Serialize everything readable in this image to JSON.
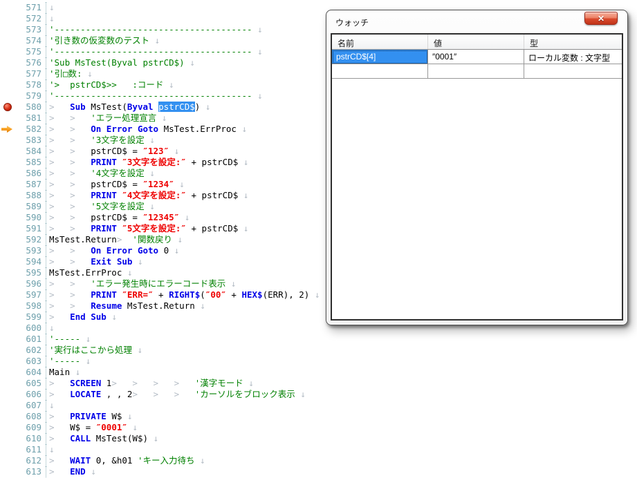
{
  "editor": {
    "colors": {
      "kw": "#0000e8",
      "str": "#ee0000",
      "cm": "#008000",
      "ws": "#b5bdc6",
      "lineno": "#6d9fab",
      "selbg": "#3390f0",
      "bp": "#d42c12",
      "arrow": "#f5991c"
    },
    "lines": [
      {
        "n": 571,
        "m": null,
        "s": [
          [
            "ws",
            "↓"
          ]
        ]
      },
      {
        "n": 572,
        "m": null,
        "s": [
          [
            "ws",
            "↓"
          ]
        ]
      },
      {
        "n": 573,
        "m": null,
        "s": [
          [
            "cm",
            "'--------------------------------------"
          ],
          [
            "ws",
            " ↓"
          ]
        ]
      },
      {
        "n": 574,
        "m": null,
        "s": [
          [
            "cm",
            "'引き数の仮変数のテスト"
          ],
          [
            "ws",
            " ↓"
          ]
        ]
      },
      {
        "n": 575,
        "m": null,
        "s": [
          [
            "cm",
            "'--------------------------------------"
          ],
          [
            "ws",
            " ↓"
          ]
        ]
      },
      {
        "n": 576,
        "m": null,
        "s": [
          [
            "cm",
            "'Sub MsTest(Byval pstrCD$)"
          ],
          [
            "ws",
            " ↓"
          ]
        ]
      },
      {
        "n": 577,
        "m": null,
        "s": [
          [
            "cm",
            "'引□数:"
          ],
          [
            "ws",
            " ↓"
          ]
        ]
      },
      {
        "n": 578,
        "m": null,
        "s": [
          [
            "cm",
            "'>  pstrCD$>>   :コード"
          ],
          [
            "ws",
            " ↓"
          ]
        ]
      },
      {
        "n": 579,
        "m": null,
        "s": [
          [
            "cm",
            "'--------------------------------------"
          ],
          [
            "ws",
            " ↓"
          ]
        ]
      },
      {
        "n": 580,
        "m": "breakpoint",
        "s": [
          [
            "ws",
            ">   "
          ],
          [
            "kw",
            "Sub "
          ],
          [
            "pl",
            "MsTest("
          ],
          [
            "kw",
            "Byval "
          ],
          [
            "sel",
            "pstrCD$"
          ],
          [
            "pl",
            ")"
          ],
          [
            "ws",
            " ↓"
          ]
        ]
      },
      {
        "n": 581,
        "m": null,
        "s": [
          [
            "ws",
            ">   >   "
          ],
          [
            "cm",
            "'エラー処理宣言"
          ],
          [
            "ws",
            " ↓"
          ]
        ]
      },
      {
        "n": 582,
        "m": "arrow",
        "s": [
          [
            "ws",
            ">   >   "
          ],
          [
            "kw",
            "On Error Goto "
          ],
          [
            "pl",
            "MsTest.ErrProc"
          ],
          [
            "ws",
            " ↓"
          ]
        ]
      },
      {
        "n": 583,
        "m": null,
        "s": [
          [
            "ws",
            ">   >   "
          ],
          [
            "cm",
            "'3文字を設定"
          ],
          [
            "ws",
            " ↓"
          ]
        ]
      },
      {
        "n": 584,
        "m": null,
        "s": [
          [
            "ws",
            ">   >   "
          ],
          [
            "pl",
            "pstrCD$ = "
          ],
          [
            "str",
            "″123″"
          ],
          [
            "ws",
            " ↓"
          ]
        ]
      },
      {
        "n": 585,
        "m": null,
        "s": [
          [
            "ws",
            ">   >   "
          ],
          [
            "kw",
            "PRINT "
          ],
          [
            "str",
            "″3文字を設定:″"
          ],
          [
            "pl",
            " + pstrCD$"
          ],
          [
            "ws",
            " ↓"
          ]
        ]
      },
      {
        "n": 586,
        "m": null,
        "s": [
          [
            "ws",
            ">   >   "
          ],
          [
            "cm",
            "'4文字を設定"
          ],
          [
            "ws",
            " ↓"
          ]
        ]
      },
      {
        "n": 587,
        "m": null,
        "s": [
          [
            "ws",
            ">   >   "
          ],
          [
            "pl",
            "pstrCD$ = "
          ],
          [
            "str",
            "″1234″"
          ],
          [
            "ws",
            " ↓"
          ]
        ]
      },
      {
        "n": 588,
        "m": null,
        "s": [
          [
            "ws",
            ">   >   "
          ],
          [
            "kw",
            "PRINT "
          ],
          [
            "str",
            "″4文字を設定:″"
          ],
          [
            "pl",
            " + pstrCD$"
          ],
          [
            "ws",
            " ↓"
          ]
        ]
      },
      {
        "n": 589,
        "m": null,
        "s": [
          [
            "ws",
            ">   >   "
          ],
          [
            "cm",
            "'5文字を設定"
          ],
          [
            "ws",
            " ↓"
          ]
        ]
      },
      {
        "n": 590,
        "m": null,
        "s": [
          [
            "ws",
            ">   >   "
          ],
          [
            "pl",
            "pstrCD$ = "
          ],
          [
            "str",
            "″12345″"
          ],
          [
            "ws",
            " ↓"
          ]
        ]
      },
      {
        "n": 591,
        "m": null,
        "s": [
          [
            "ws",
            ">   >   "
          ],
          [
            "kw",
            "PRINT "
          ],
          [
            "str",
            "″5文字を設定:″"
          ],
          [
            "pl",
            " + pstrCD$"
          ],
          [
            "ws",
            " ↓"
          ]
        ]
      },
      {
        "n": 592,
        "m": null,
        "s": [
          [
            "pl",
            "MsTest.Return"
          ],
          [
            "ws",
            ">  "
          ],
          [
            "cm",
            "'関数戻り"
          ],
          [
            "ws",
            " ↓"
          ]
        ]
      },
      {
        "n": 593,
        "m": null,
        "s": [
          [
            "ws",
            ">   >   "
          ],
          [
            "kw",
            "On Error Goto "
          ],
          [
            "pl",
            "0"
          ],
          [
            "ws",
            " ↓"
          ]
        ]
      },
      {
        "n": 594,
        "m": null,
        "s": [
          [
            "ws",
            ">   >   "
          ],
          [
            "kw",
            "Exit Sub"
          ],
          [
            "ws",
            " ↓"
          ]
        ]
      },
      {
        "n": 595,
        "m": null,
        "s": [
          [
            "pl",
            "MsTest.ErrProc"
          ],
          [
            "ws",
            " ↓"
          ]
        ]
      },
      {
        "n": 596,
        "m": null,
        "s": [
          [
            "ws",
            ">   >   "
          ],
          [
            "cm",
            "'エラー発生時にエラーコード表示"
          ],
          [
            "ws",
            " ↓"
          ]
        ]
      },
      {
        "n": 597,
        "m": null,
        "s": [
          [
            "ws",
            ">   >   "
          ],
          [
            "kw",
            "PRINT "
          ],
          [
            "str",
            "″ERR=″"
          ],
          [
            "pl",
            " + "
          ],
          [
            "kw",
            "RIGHT$"
          ],
          [
            "pl",
            "("
          ],
          [
            "str",
            "″00″"
          ],
          [
            "pl",
            " + "
          ],
          [
            "kw",
            "HEX$"
          ],
          [
            "pl",
            "(ERR), 2)"
          ],
          [
            "ws",
            " ↓"
          ]
        ]
      },
      {
        "n": 598,
        "m": null,
        "s": [
          [
            "ws",
            ">   >   "
          ],
          [
            "kw",
            "Resume "
          ],
          [
            "pl",
            "MsTest.Return"
          ],
          [
            "ws",
            " ↓"
          ]
        ]
      },
      {
        "n": 599,
        "m": null,
        "s": [
          [
            "ws",
            ">   "
          ],
          [
            "kw",
            "End Sub"
          ],
          [
            "ws",
            " ↓"
          ]
        ]
      },
      {
        "n": 600,
        "m": null,
        "s": [
          [
            "ws",
            "↓"
          ]
        ]
      },
      {
        "n": 601,
        "m": null,
        "s": [
          [
            "cm",
            "'-----"
          ],
          [
            "ws",
            " ↓"
          ]
        ]
      },
      {
        "n": 602,
        "m": null,
        "s": [
          [
            "cm",
            "'実行はここから処理"
          ],
          [
            "ws",
            " ↓"
          ]
        ]
      },
      {
        "n": 603,
        "m": null,
        "s": [
          [
            "cm",
            "'-----"
          ],
          [
            "ws",
            " ↓"
          ]
        ]
      },
      {
        "n": 604,
        "m": null,
        "s": [
          [
            "pl",
            "Main"
          ],
          [
            "ws",
            " ↓"
          ]
        ]
      },
      {
        "n": 605,
        "m": null,
        "s": [
          [
            "ws",
            ">   "
          ],
          [
            "kw",
            "SCREEN "
          ],
          [
            "pl",
            "1"
          ],
          [
            "ws",
            ">   >   >   >   "
          ],
          [
            "cm",
            "'漢字モード"
          ],
          [
            "ws",
            " ↓"
          ]
        ]
      },
      {
        "n": 606,
        "m": null,
        "s": [
          [
            "ws",
            ">   "
          ],
          [
            "kw",
            "LOCATE "
          ],
          [
            "pl",
            ", , 2"
          ],
          [
            "ws",
            ">   >   >   "
          ],
          [
            "cm",
            "'カーソルをブロック表示"
          ],
          [
            "ws",
            " ↓"
          ]
        ]
      },
      {
        "n": 607,
        "m": null,
        "s": [
          [
            "ws",
            "↓"
          ]
        ]
      },
      {
        "n": 608,
        "m": null,
        "s": [
          [
            "ws",
            ">   "
          ],
          [
            "kw",
            "PRIVATE "
          ],
          [
            "pl",
            "W$"
          ],
          [
            "ws",
            " ↓"
          ]
        ]
      },
      {
        "n": 609,
        "m": null,
        "s": [
          [
            "ws",
            ">   "
          ],
          [
            "pl",
            "W$ = "
          ],
          [
            "str",
            "″0001″"
          ],
          [
            "ws",
            " ↓"
          ]
        ]
      },
      {
        "n": 610,
        "m": null,
        "s": [
          [
            "ws",
            ">   "
          ],
          [
            "kw",
            "CALL "
          ],
          [
            "pl",
            "MsTest(W$)"
          ],
          [
            "ws",
            " ↓"
          ]
        ]
      },
      {
        "n": 611,
        "m": null,
        "s": [
          [
            "ws",
            "↓"
          ]
        ]
      },
      {
        "n": 612,
        "m": null,
        "s": [
          [
            "ws",
            ">   "
          ],
          [
            "kw",
            "WAIT "
          ],
          [
            "pl",
            "0, &h01 "
          ],
          [
            "cm",
            "'キー入力待ち"
          ],
          [
            "ws",
            " ↓"
          ]
        ]
      },
      {
        "n": 613,
        "m": null,
        "s": [
          [
            "ws",
            ">   "
          ],
          [
            "kw",
            "END"
          ],
          [
            "ws",
            " ↓"
          ]
        ]
      }
    ]
  },
  "watch": {
    "title": "ウォッチ",
    "close_glyph": "✕",
    "columns": [
      "名前",
      "値",
      "型"
    ],
    "rows": [
      {
        "name": "pstrCD$[4]",
        "value": "″0001″",
        "type": "ローカル変数 : 文字型",
        "selected": true
      },
      {
        "name": "",
        "value": "",
        "type": "",
        "selected": false
      }
    ]
  }
}
